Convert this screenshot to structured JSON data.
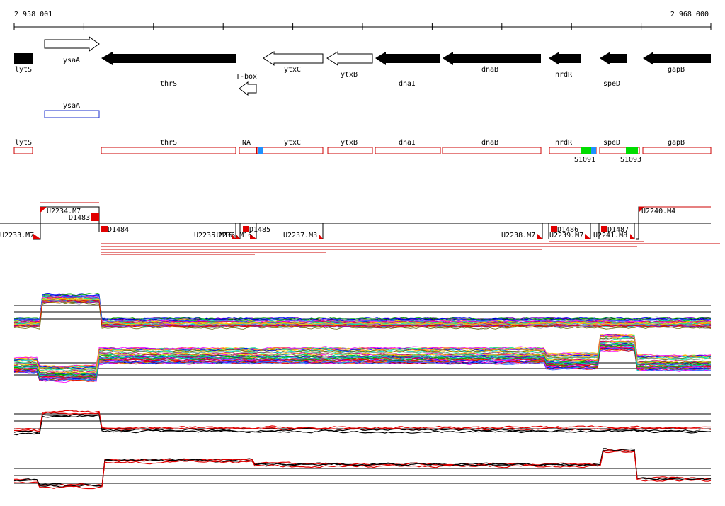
{
  "ruler": {
    "start_label": "2 958 001",
    "end_label": "2 968 000"
  },
  "genes": [
    {
      "label": "lytS"
    },
    {
      "label": "ysaA"
    },
    {
      "label": "thrS"
    },
    {
      "label": "T-box"
    },
    {
      "label": "ytxC"
    },
    {
      "label": "ytxB"
    },
    {
      "label": "dnaI"
    },
    {
      "label": "dnaB"
    },
    {
      "label": "nrdR"
    },
    {
      "label": "speD"
    },
    {
      "label": "gapB"
    }
  ],
  "ysaA_box_label": "ysaA",
  "annotation_boxes": [
    {
      "label": "lytS"
    },
    {
      "label": "thrS"
    },
    {
      "label": "NA"
    },
    {
      "label": "ytxC"
    },
    {
      "label": "ytxB"
    },
    {
      "label": "dnaI"
    },
    {
      "label": "dnaB"
    },
    {
      "label": "nrdR"
    },
    {
      "label": "speD"
    },
    {
      "label": "gapB"
    }
  ],
  "sites": [
    {
      "label": "S1091"
    },
    {
      "label": "S1093"
    }
  ],
  "segments": [
    {
      "label": "U2233.M7"
    },
    {
      "label": "U2234.M7"
    },
    {
      "label": "D1483"
    },
    {
      "label": "D1484"
    },
    {
      "label": "U2235.M16"
    },
    {
      "label": "U2236.M16"
    },
    {
      "label": "D1485"
    },
    {
      "label": "U2237.M3"
    },
    {
      "label": "U2238.M7"
    },
    {
      "label": "D1486"
    },
    {
      "label": "U2239.M7"
    },
    {
      "label": "D1487"
    },
    {
      "label": "U2241.M8"
    },
    {
      "label": "U2240.M4"
    }
  ],
  "colors": {
    "gene_fill": "#000000",
    "outline": "#cc0000",
    "blue_site": "#1e90ff",
    "green_site": "#00dd00",
    "ysaA_box": "#1a2ccc",
    "profile_red": "#e00000"
  }
}
